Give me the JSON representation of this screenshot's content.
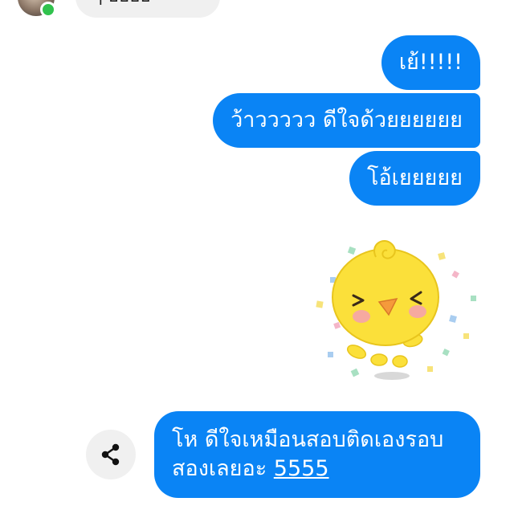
{
  "conversation": {
    "incoming_partial_text": "ๆ อิอิอิอิ",
    "messages": [
      {
        "text": "เย้!!!!!"
      },
      {
        "text": "ว้าววววว ดีใจด้วยยยยยย"
      },
      {
        "text": "โอ้เยยยยย"
      }
    ],
    "last_message": {
      "line1": "โห ดีใจเหมือนสอบติดเองรอบ",
      "line2": "สองเลยอะ",
      "link_text": "5555"
    }
  },
  "sticker": {
    "icon": "happy-yellow-chick-sticker"
  },
  "share": {
    "icon": "share-icon"
  },
  "colors": {
    "outgoing_bubble": "#0a84f5",
    "incoming_bubble": "#f0f0f0",
    "online_status": "#31c24d",
    "sticker_body": "#fbe03a",
    "sticker_cheek": "#f6a9a0"
  }
}
